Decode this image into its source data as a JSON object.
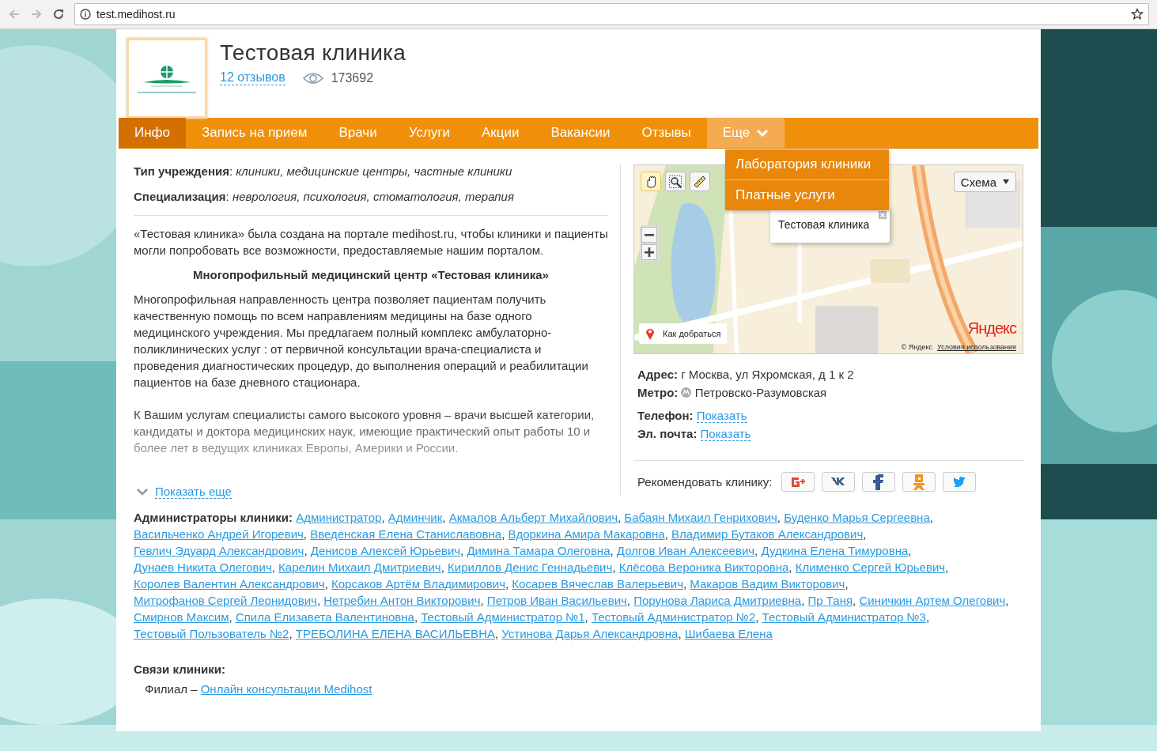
{
  "browser": {
    "url": "test.medihost.ru"
  },
  "clinic": {
    "name": "Тестовая клиника",
    "reviews": "12 отзывов",
    "views": "173692"
  },
  "nav": {
    "tabs": [
      {
        "label": "Инфо",
        "selected": true,
        "expanded": false,
        "kind": "plain"
      },
      {
        "label": "Запись на прием",
        "selected": false,
        "expanded": false,
        "kind": "plain"
      },
      {
        "label": "Врачи",
        "selected": false,
        "expanded": false,
        "kind": "plain"
      },
      {
        "label": "Услуги",
        "selected": false,
        "expanded": false,
        "kind": "plain"
      },
      {
        "label": "Акции",
        "selected": false,
        "expanded": false,
        "kind": "plain"
      },
      {
        "label": "Вакансии",
        "selected": false,
        "expanded": false,
        "kind": "plain"
      },
      {
        "label": "Отзывы",
        "selected": false,
        "expanded": false,
        "kind": "plain"
      },
      {
        "label": "Еще",
        "selected": false,
        "expanded": true,
        "kind": "menu",
        "items": [
          "Лаборатория клиники",
          "Платные услуги"
        ]
      }
    ]
  },
  "info": {
    "fields": [
      "**Тип учреждения**: *клиники, медицинские центры, частные клиники*",
      "**Специализация**: *неврология, психология, стоматология, терапия*"
    ]
  },
  "description": {
    "collapsed": true,
    "blocks": [
      {
        "kind": "text",
        "text": "«Тестовая клиника» была создана на портале medihost.ru, чтобы клиники и пациенты могли попробовать все возможности, предоставляемые нашим порталом."
      },
      {
        "kind": "heading",
        "text": "Многопрофильный медицинский центр «Тестовая клиника»"
      },
      {
        "kind": "text",
        "text": "Многопрофильная направленность центра позволяет пациентам получить качественную помощь по всем направлениям  медицины  на базе одного медицинского учреждения.  Мы предлагаем полный  комплекс амбулаторно-поликлинических услуг : от первичной консультации врача-специалиста и проведения диагностических процедур,  до выполнения операций и реабилитации пациентов на базе дневного стационара."
      },
      {
        "kind": "text",
        "text": "К Вашим услугам специалисты самого высокого уровня – врачи высшей категории, кандидаты и доктора медицинских наук, имеющие практический опыт работы 10 и более лет в ведущих клиниках Европы, Америки и России."
      }
    ],
    "show_more": "Показать еще"
  },
  "map": {
    "tools": [
      {
        "kind": "hand",
        "selected": true
      },
      {
        "kind": "magnifier",
        "selected": false
      },
      {
        "kind": "ruler",
        "selected": false
      }
    ],
    "layer": "Схема",
    "balloon": "Тестовая клиника",
    "route": "Как добраться",
    "logo": "Яндекс",
    "copyright": "© Яндекс",
    "terms": "Условия использования"
  },
  "contacts": {
    "groups": [
      [
        {
          "kind": "text",
          "label": "Адрес:",
          "value": "г Москва, ул Яхромская, д 1 к 2"
        },
        {
          "kind": "metro",
          "label": "Метро:",
          "value": "Петровско-Разумовская"
        }
      ],
      [
        {
          "kind": "link",
          "label": "Телефон:",
          "value": "Показать"
        },
        {
          "kind": "link",
          "label": "Эл. почта:",
          "value": "Показать"
        }
      ]
    ]
  },
  "share": {
    "label": "Рекомендовать клинику:",
    "buttons": [
      {
        "kind": "gplus",
        "color": "#dd4b39"
      },
      {
        "kind": "vk",
        "color": "#4a6a8f"
      },
      {
        "kind": "facebook",
        "color": "#3b5998"
      },
      {
        "kind": "ok",
        "color": "#f7931e"
      },
      {
        "kind": "twitter",
        "color": "#1da1f2"
      }
    ]
  },
  "admins": {
    "label": "Администраторы клиники:",
    "separator": ", ",
    "people": [
      "Администратор",
      "Админчик",
      "Акмалов Альберт Михайлович",
      "Бабаян Михаил Генрихович",
      "Буденко Марья Сергеевна",
      "Васильченко Андрей Игоревич",
      "Введенская Елена Станиславовна",
      "Вдоркина Амира Макаровна",
      "Владимир Бутаков Александрович",
      "Гевлич Эдуард Александрович",
      "Денисов Алексей Юрьевич",
      "Димина Тамара Олеговна",
      "Долгов Иван Алексеевич",
      "Дудкина Елена Тимуровна",
      "Дунаев Никита Олегович",
      "Карелин Михаил Дмитриевич",
      "Кириллов Денис Геннадьевич",
      "Клёсова Вероника Викторовна",
      "Клименко Сергей Юрьевич",
      "Королев Валентин Александрович",
      "Корсаков Артём Владимирович",
      "Косарев Вячеслав Валерьевич",
      "Макаров Вадим Викторович",
      "Митрофанов Сергей Леонидович",
      "Нетребин Антон Викторович",
      "Петров Иван Васильевич",
      "Порунова Лариса Дмитриевна",
      "Пр Таня",
      "Синичкин Артем Олегович",
      "Смирнов Максим",
      "Спила Елизавета Валентиновна",
      "Тестовый Администратор №1",
      "Тестовый Администратор №2",
      "Тестовый Администратор №3",
      "Тестовый Пользователь №2",
      "ТРЕБОЛИНА ЕЛЕНА ВАСИЛЬЕВНА",
      "Устинова Дарья Александровна",
      "Шибаева Елена"
    ]
  },
  "relations": {
    "label": "Связи клиники:",
    "items": [
      {
        "prefix": "Филиал –",
        "link": "Онлайн консультации Medihost"
      }
    ]
  }
}
